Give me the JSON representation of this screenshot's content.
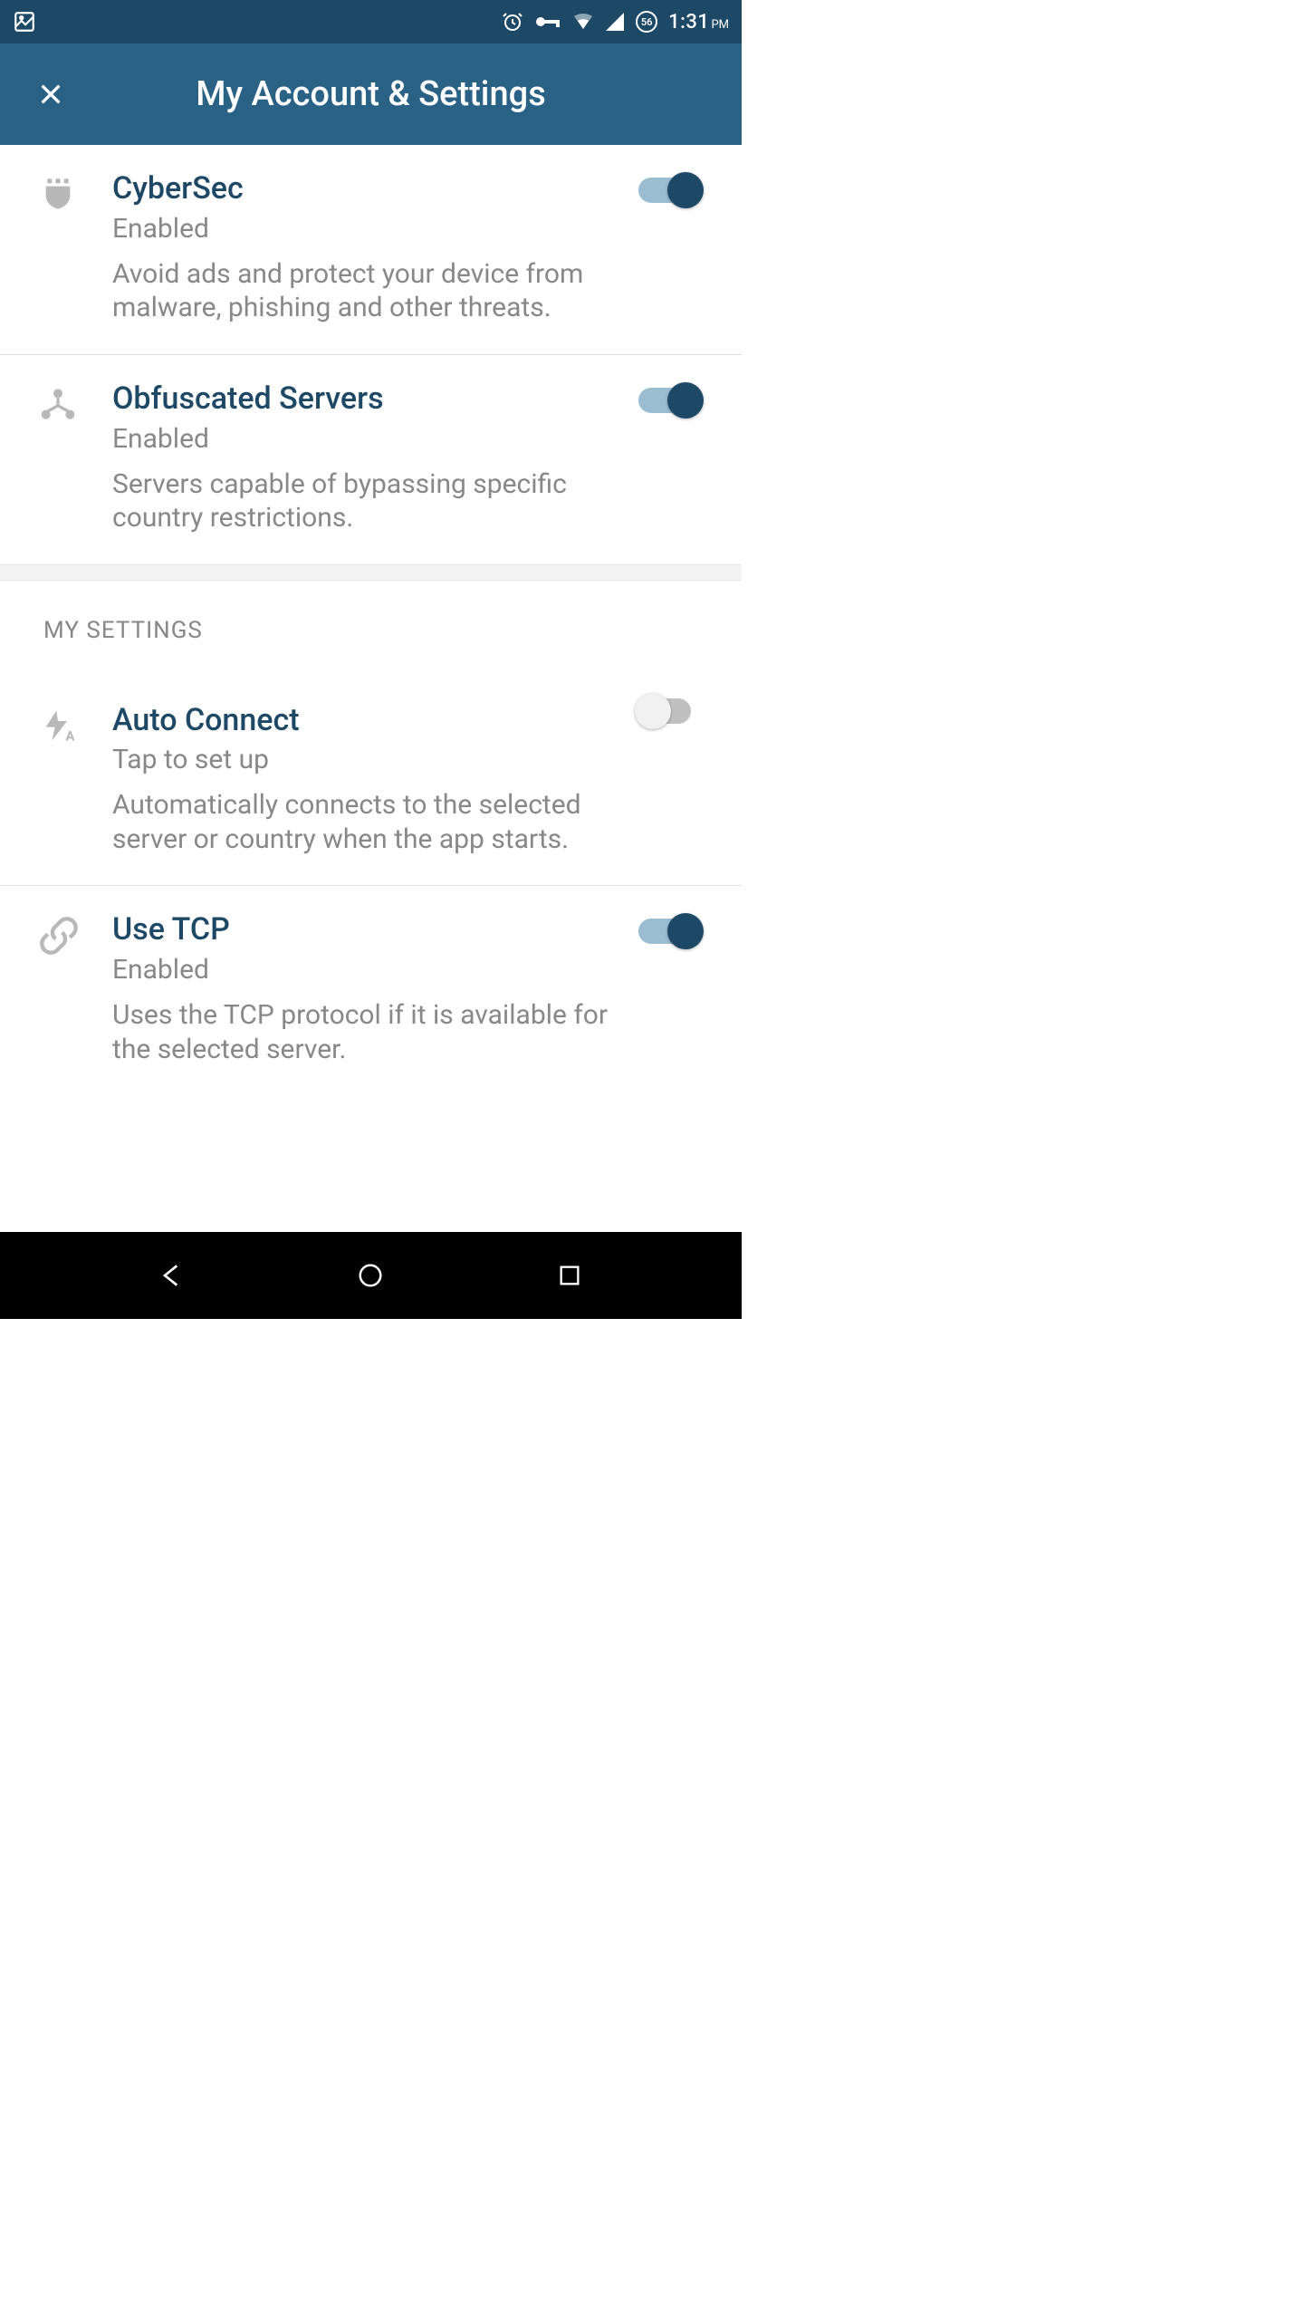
{
  "status_bar": {
    "time": "1:31",
    "ampm": "PM",
    "data_badge": "56"
  },
  "header": {
    "title": "My Account & Settings"
  },
  "sections": {
    "top": [
      {
        "title": "CyberSec",
        "status": "Enabled",
        "description": "Avoid ads and protect your device from malware, phishing and other threats.",
        "enabled": true
      },
      {
        "title": "Obfuscated Servers",
        "status": "Enabled",
        "description": "Servers capable of bypassing specific country restrictions.",
        "enabled": true
      }
    ],
    "my_settings_label": "MY SETTINGS",
    "my_settings": [
      {
        "title": "Auto Connect",
        "status": "Tap to set up",
        "description": "Automatically connects to the selected server or country when the app starts.",
        "enabled": false
      },
      {
        "title": "Use TCP",
        "status": "Enabled",
        "description": "Uses the TCP protocol if it is available for the selected server.",
        "enabled": true
      }
    ]
  }
}
